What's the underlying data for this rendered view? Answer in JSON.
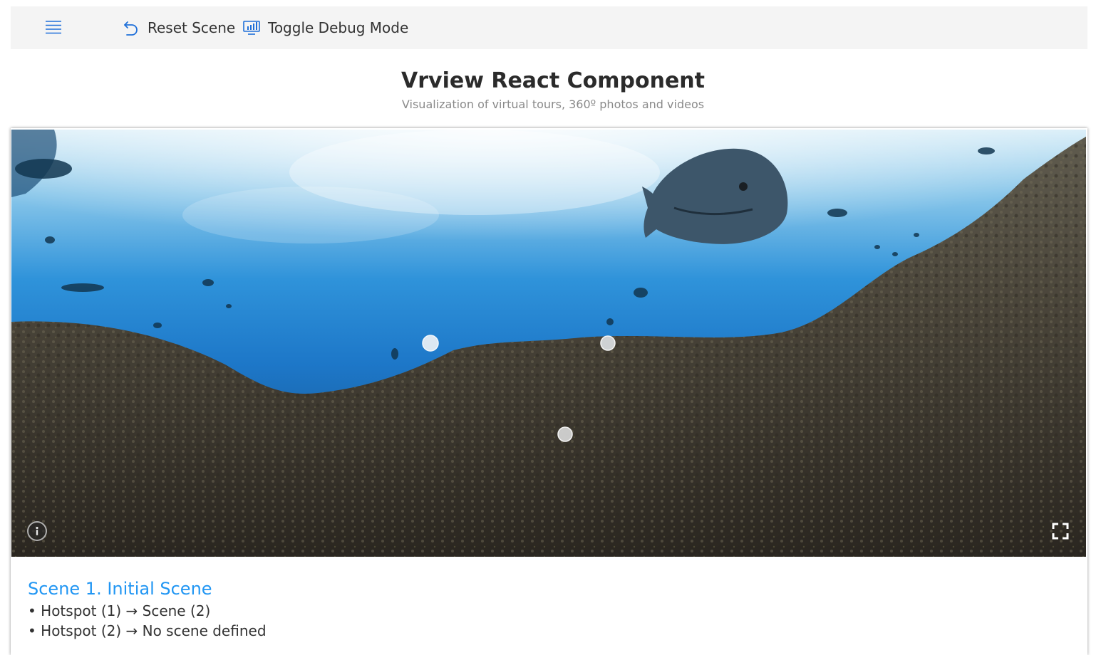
{
  "toolbar": {
    "menu_icon": "hamburger-icon",
    "reset_label": "Reset Scene",
    "reset_icon": "undo-icon",
    "debug_label": "Toggle Debug Mode",
    "debug_icon": "chart-monitor-icon",
    "icon_color": "#1e6fd9"
  },
  "header": {
    "title": "Vrview React Component",
    "subtitle": "Visualization of virtual tours, 360º photos and videos"
  },
  "viewer": {
    "info_icon": "info-icon",
    "fullscreen_icon": "fullscreen-icon",
    "hotspot_count": 3
  },
  "scene": {
    "title": "Scene 1. Initial Scene",
    "hotspots": [
      "• Hotspot (1) → Scene (2)",
      "• Hotspot (2) → No scene defined"
    ],
    "title_color": "#2196f3"
  }
}
